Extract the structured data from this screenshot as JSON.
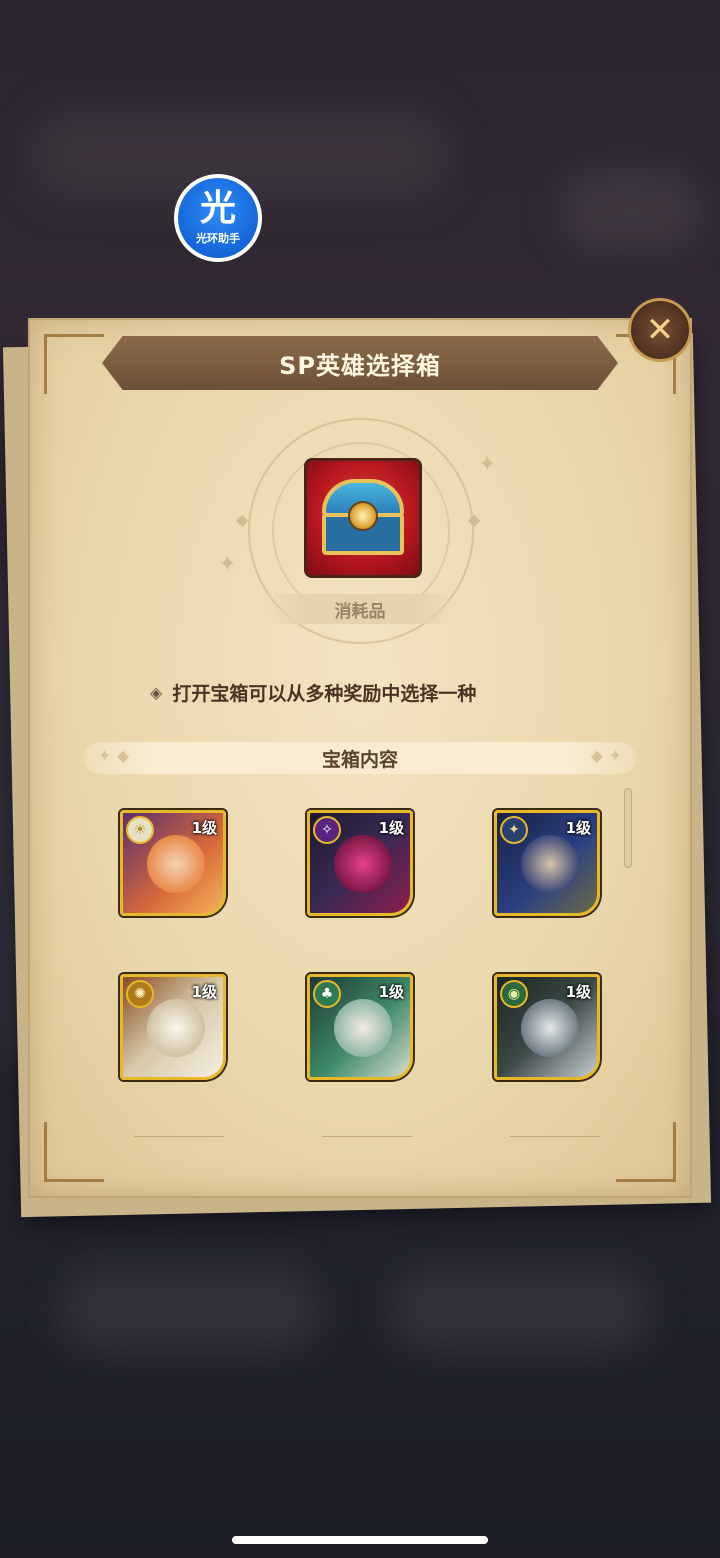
{
  "helper_badge": {
    "char": "光",
    "label": "光环助手"
  },
  "dialog": {
    "title": "SP英雄选择箱",
    "close_icon": "close-x-icon",
    "item": {
      "icon": "treasure-chest-icon",
      "category": "消耗品"
    },
    "description": "打开宝箱可以从多种奖励中选择一种",
    "section_title": "宝箱内容",
    "heroes": [
      {
        "level": "1级",
        "faction": "lightbearer",
        "color": "#e88a4a"
      },
      {
        "level": "1级",
        "faction": "hypogean",
        "color": "#c8286a"
      },
      {
        "level": "1级",
        "faction": "celestial",
        "color": "#2a3f82"
      },
      {
        "level": "1级",
        "faction": "graveborn",
        "color": "#f1ead8"
      },
      {
        "level": "1级",
        "faction": "wilder",
        "color": "#3f8a6a"
      },
      {
        "level": "1级",
        "faction": "wilder",
        "color": "#9aa6b2"
      }
    ]
  },
  "colors": {
    "accent_gold": "#e7b829",
    "banner_brown": "#7a5a3f",
    "paper": "#ead6ab"
  }
}
